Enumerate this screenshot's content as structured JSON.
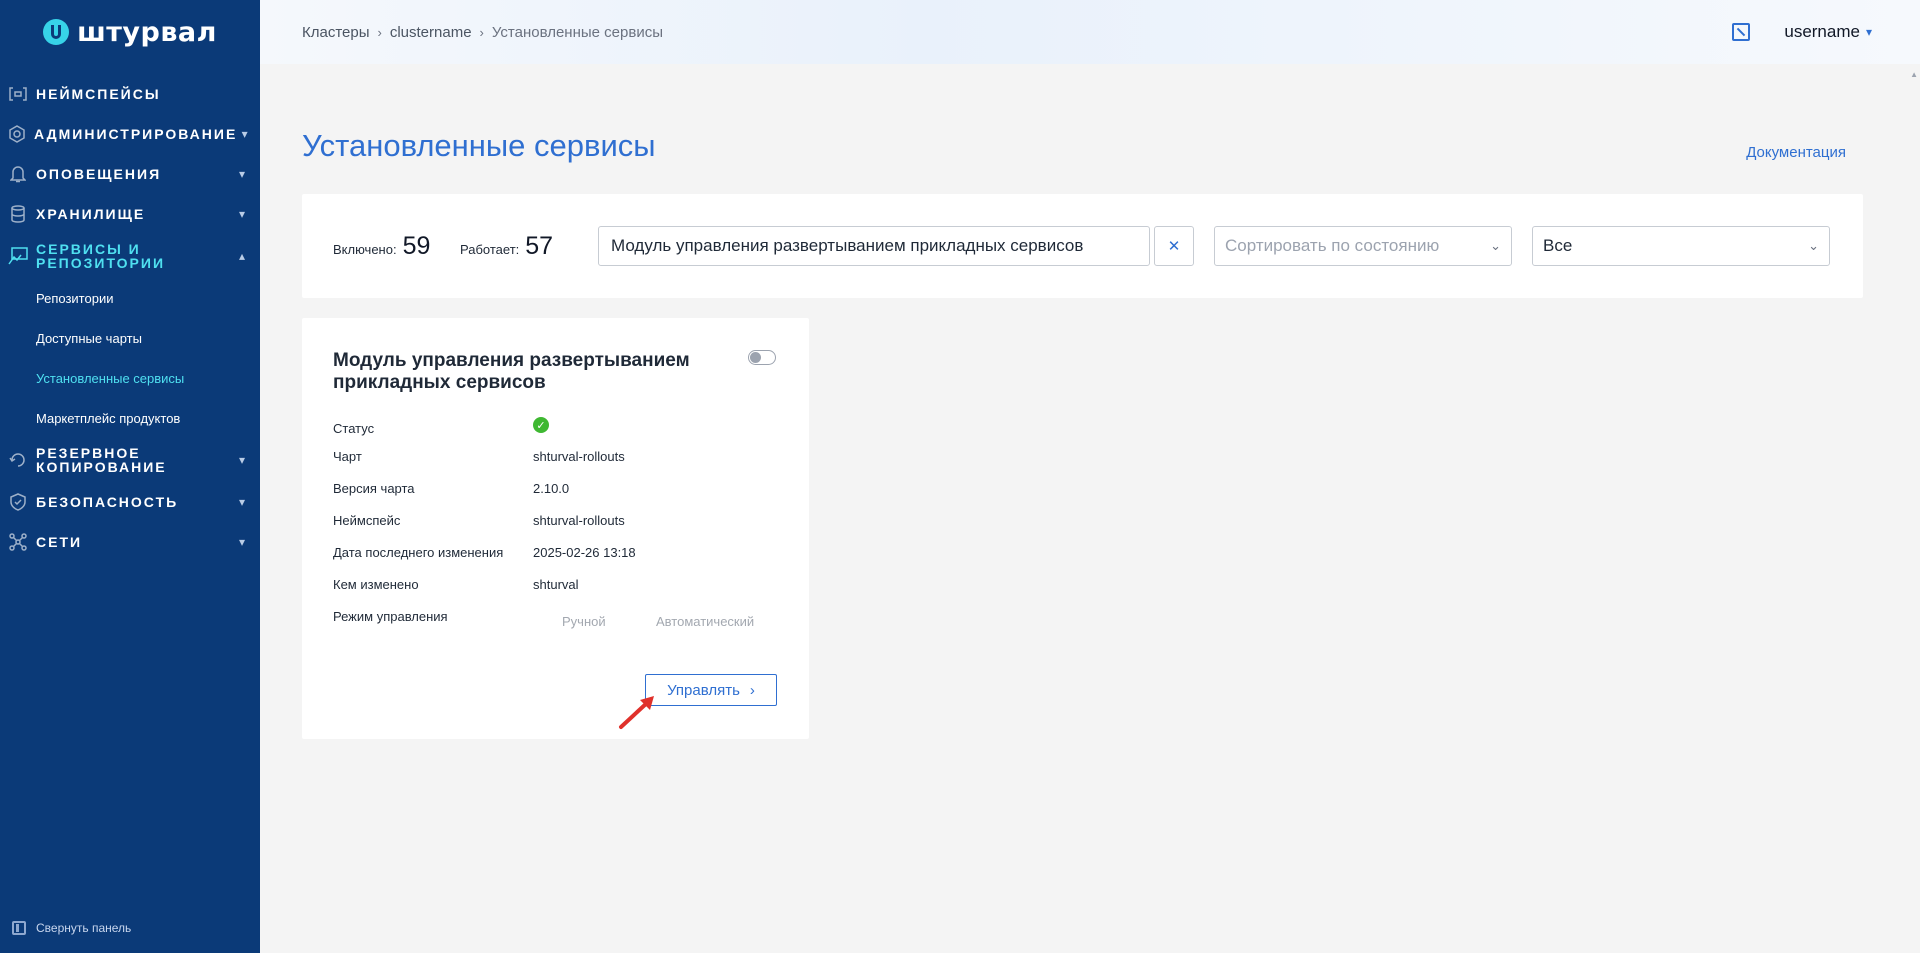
{
  "brand": {
    "name": "штурвал"
  },
  "sidebar": {
    "items": [
      {
        "label": "Неймспейсы",
        "icon": "namespace-icon",
        "expandable": false
      },
      {
        "label": "Администрирование",
        "icon": "gear-icon",
        "expandable": true
      },
      {
        "label": "Оповещения",
        "icon": "bell-icon",
        "expandable": true
      },
      {
        "label": "Хранилище",
        "icon": "database-icon",
        "expandable": true
      },
      {
        "label": "Сервисы и репозитории",
        "icon": "services-icon",
        "expandable": true,
        "expanded": true,
        "children": [
          "Репозитории",
          "Доступные чарты",
          "Установленные сервисы",
          "Маркетплейс продуктов"
        ],
        "active_child": "Установленные сервисы"
      },
      {
        "label": "Резервное копирование",
        "icon": "backup-icon",
        "expandable": true
      },
      {
        "label": "Безопасность",
        "icon": "shield-icon",
        "expandable": true
      },
      {
        "label": "Сети",
        "icon": "network-icon",
        "expandable": true
      }
    ],
    "collapse_label": "Свернуть панель"
  },
  "header": {
    "breadcrumbs": [
      "Кластеры",
      "clustername",
      "Установленные сервисы"
    ],
    "username": "username"
  },
  "main": {
    "title": "Установленные сервисы",
    "doc_link": "Документация",
    "stats": {
      "enabled_label": "Включено:",
      "enabled_value": "59",
      "running_label": "Работает:",
      "running_value": "57"
    },
    "search_value": "Модуль управления развертыванием прикладных сервисов",
    "sort_placeholder": "Сортировать по состоянию",
    "filter_value": "Все"
  },
  "card": {
    "title": "Модуль управления развертыванием прикладных сервисов",
    "enabled": false,
    "fields": {
      "status_label": "Статус",
      "chart_label": "Чарт",
      "chart_value": "shturval-rollouts",
      "version_label": "Версия чарта",
      "version_value": "2.10.0",
      "namespace_label": "Неймспейс",
      "namespace_value": "shturval-rollouts",
      "modified_label": "Дата последнего изменения",
      "modified_value": "2025-02-26 13:18",
      "by_label": "Кем изменено",
      "by_value": "shturval",
      "mode_label": "Режим управления",
      "mode_manual": "Ручной",
      "mode_auto": "Автоматический"
    },
    "manage_label": "Управлять"
  },
  "colors": {
    "sidebar_bg": "#0b3a78",
    "accent": "#2f6fd1",
    "active_cyan": "#4fe0f0",
    "status_ok": "#3fb832"
  }
}
